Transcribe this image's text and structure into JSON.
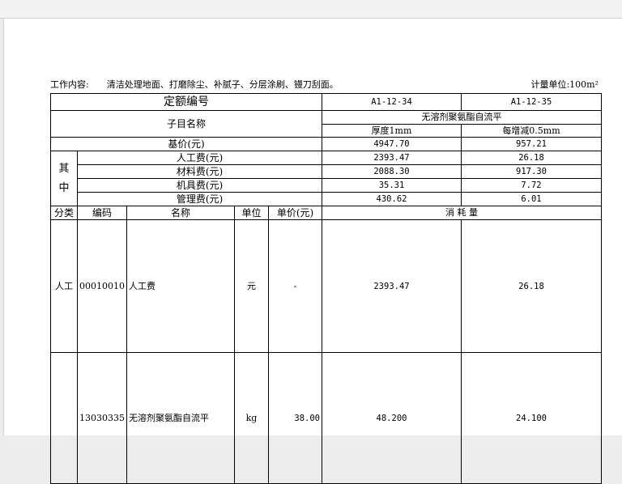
{
  "header": {
    "work_label": "工作内容:",
    "work_content": "清洁处理地面、打磨除尘、补腻子、分层涂刷、镘刀刮面。",
    "unit_label": "计量单位:100m²"
  },
  "table": {
    "quota_label": "定额编号",
    "codes": [
      "A1-12-34",
      "A1-12-35"
    ],
    "subitem_label": "子目名称",
    "group_name": "无溶剂聚氨酯自流平",
    "sub_names": [
      "厚度1mm",
      "每增减0.5mm"
    ],
    "base_price": {
      "label": "基价(元)",
      "values": [
        "4947.70",
        "957.21"
      ]
    },
    "among_label": [
      "其",
      "中"
    ],
    "costs": [
      {
        "label": "人工费(元)",
        "values": [
          "2393.47",
          "26.18"
        ]
      },
      {
        "label": "材料费(元)",
        "values": [
          "2088.30",
          "917.30"
        ]
      },
      {
        "label": "机具费(元)",
        "values": [
          "35.31",
          "7.72"
        ]
      },
      {
        "label": "管理费(元)",
        "values": [
          "430.62",
          "6.01"
        ]
      }
    ],
    "columns": {
      "category": "分类",
      "code": "编码",
      "name": "名称",
      "unit": "单位",
      "price": "单价(元)",
      "consumption": "消 耗 量"
    },
    "rows": [
      {
        "category": "人工",
        "code": "00010010",
        "name": "人工费",
        "unit": "元",
        "price": "-",
        "values": [
          "2393.47",
          "26.18"
        ]
      },
      {
        "category": "",
        "code": "13030335",
        "name": "无溶剂聚氨酯自流平",
        "unit": "kg",
        "price": "38.00",
        "values": [
          "48.200",
          "24.100"
        ]
      }
    ]
  }
}
